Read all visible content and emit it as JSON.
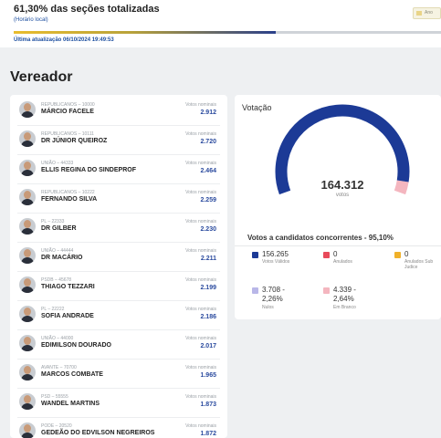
{
  "header": {
    "percent_title": "61,30% das seções totalizadas",
    "hora_link": "(Horário local)",
    "update_text": "Última atualização 06/10/2024 19:49:53",
    "progress": 0.613,
    "right_button_label": "Ano"
  },
  "section_title": "Vereador",
  "candidates": [
    {
      "party": "REPUBLICANOS – 10000",
      "name": "MÁRCIO FACELE",
      "status": "Votos nominais",
      "votes": "2.912"
    },
    {
      "party": "REPUBLICANOS – 10111",
      "name": "DR JÚNIOR QUEIROZ",
      "status": "Votos nominais",
      "votes": "2.720"
    },
    {
      "party": "UNIÃO – 44333",
      "name": "ELLIS REGINA DO SINDEPROF",
      "status": "Votos nominais",
      "votes": "2.464"
    },
    {
      "party": "REPUBLICANOS – 10222",
      "name": "FERNANDO SILVA",
      "status": "Votos nominais",
      "votes": "2.259"
    },
    {
      "party": "PL – 22333",
      "name": "DR GILBER",
      "status": "Votos nominais",
      "votes": "2.230"
    },
    {
      "party": "UNIÃO – 44444",
      "name": "DR MACÁRIO",
      "status": "Votos nominais",
      "votes": "2.211"
    },
    {
      "party": "PSDB – 45678",
      "name": "THIAGO TEZZARI",
      "status": "Votos nominais",
      "votes": "2.199"
    },
    {
      "party": "PL – 22222",
      "name": "SOFIA ANDRADE",
      "status": "Votos nominais",
      "votes": "2.186"
    },
    {
      "party": "UNIÃO – 44000",
      "name": "EDIMILSON DOURADO",
      "status": "Votos nominais",
      "votes": "2.017"
    },
    {
      "party": "AVANTE – 70700",
      "name": "MARCOS COMBATE",
      "status": "Votos nominais",
      "votes": "1.965"
    },
    {
      "party": "PSD – 55555",
      "name": "WANDEL MARTINS",
      "status": "Votos nominais",
      "votes": "1.873"
    },
    {
      "party": "PODE – 20520",
      "name": "GEDEÃO DO EDVILSON NEGREIROS",
      "status": "Votos nominais",
      "votes": "1.872"
    }
  ],
  "votacao": {
    "title": "Votação",
    "total": "164.312",
    "total_label": "votos",
    "gauge_fill": 0.95,
    "concorrentes_title": "Votos a candidatos concorrentes - 95,10%",
    "stats": [
      {
        "value": "156.265",
        "label": "Votos Válidos",
        "color": "#1c3a96"
      },
      {
        "value": "0",
        "label": "Anulados",
        "color": "#e84a5a"
      },
      {
        "value": "0",
        "label": "Anulados Sub Judice",
        "color": "#f0b12a"
      },
      {
        "value": "3.708 - 2,26%",
        "label": "Nulos",
        "color": "#b9b7e8"
      },
      {
        "value": "4.339 - 2,64%",
        "label": "Em Branco",
        "color": "#f4b6bf"
      }
    ]
  },
  "colors": {
    "primary": "#1c3a96",
    "link": "#1d4fa0",
    "gauge_rest": "#f4b6bf"
  }
}
